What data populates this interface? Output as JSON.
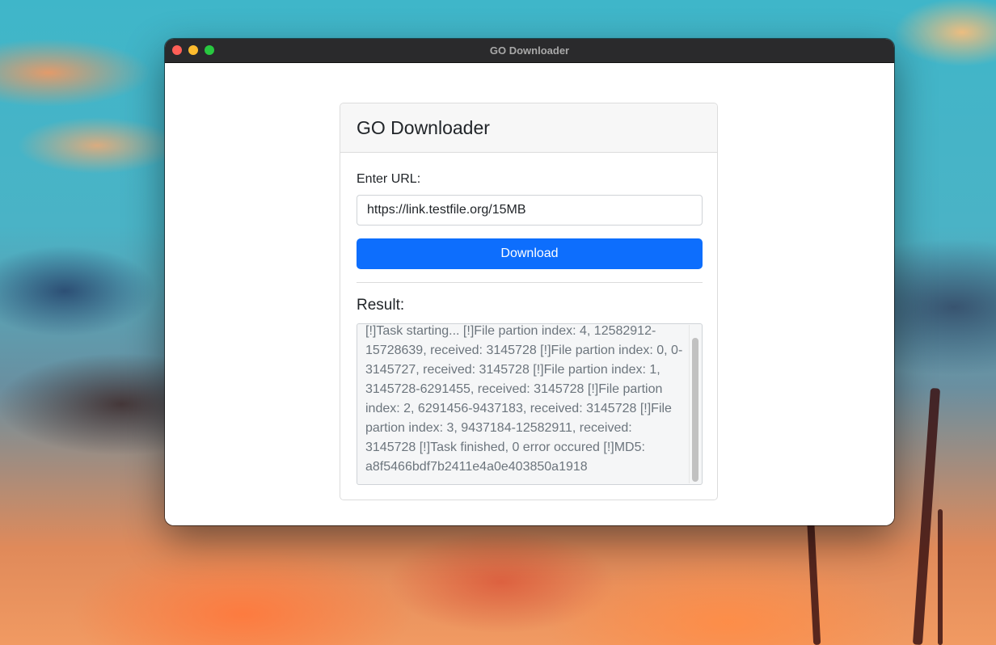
{
  "window": {
    "title": "GO Downloader"
  },
  "card": {
    "title": "GO Downloader",
    "url_label": "Enter URL:",
    "url_value": "https://link.testfile.org/15MB",
    "download_label": "Download",
    "result_label": "Result:",
    "result_text": "[!]Task starting... [!]File partion index: 4, 12582912-15728639, received: 3145728 [!]File partion index: 0, 0-3145727, received: 3145728 [!]File partion index: 1, 3145728-6291455, received: 3145728 [!]File partion index: 2, 6291456-9437183, received: 3145728 [!]File partion index: 3, 9437184-12582911, received: 3145728 [!]Task finished, 0 error occured [!]MD5: a8f5466bdf7b2411e4a0e403850a1918"
  },
  "colors": {
    "primary_button": "#0d6efd",
    "close_dot": "#ff5f57",
    "minimize_dot": "#febc2e",
    "maximize_dot": "#28c840"
  }
}
